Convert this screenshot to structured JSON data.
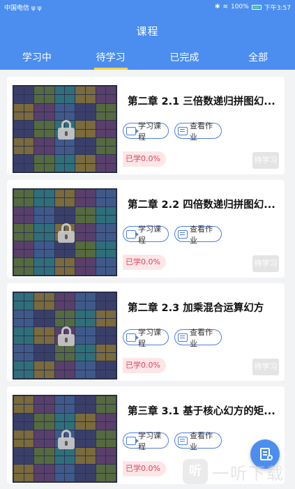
{
  "status_bar": {
    "carrier": "中国电信 ψ ψ",
    "battery": "100%",
    "time": "下午3:57"
  },
  "header": {
    "title": "课程"
  },
  "tabs": [
    {
      "label": "学习中",
      "active": false
    },
    {
      "label": "待学习",
      "active": true
    },
    {
      "label": "已完成",
      "active": false
    },
    {
      "label": "全部",
      "active": false
    }
  ],
  "courses": [
    {
      "title": "第二章  2.1 三倍数递归拼图幻...",
      "course_btn": "学习课程",
      "homework_btn": "查看作业",
      "progress": "已学0.0%",
      "status": "待学习",
      "locked": true
    },
    {
      "title": "第二章  2.2 四倍数递归拼图幻...",
      "course_btn": "学习课程",
      "homework_btn": "查看作业",
      "progress": "已学0.0%",
      "status": "待学习",
      "locked": true
    },
    {
      "title": "第二章  2.3 加乘混合运算幻方",
      "course_btn": "学习课程",
      "homework_btn": "查看作业",
      "progress": "已学0.0%",
      "status": "待学习",
      "locked": true
    },
    {
      "title": "第三章  3.1 基于核心幻方的矩...",
      "course_btn": "学习课程",
      "homework_btn": "查看作业",
      "progress": "已学0.0%",
      "status": "",
      "locked": true
    }
  ],
  "watermark": {
    "logo": "听",
    "text": "一听下载"
  },
  "colors": {
    "primary": "#4c8ef0",
    "tab_indicator": "#ffd43b",
    "progress_text": "#e0435a",
    "progress_bg": "#fde6e8"
  }
}
